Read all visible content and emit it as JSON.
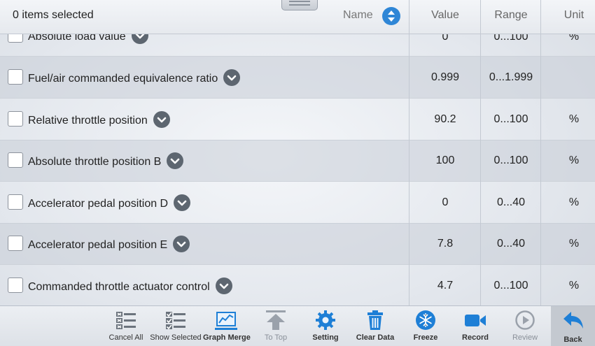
{
  "header": {
    "selection_text": "0 items selected",
    "sort_label": "Name",
    "col_value": "Value",
    "col_range": "Range",
    "col_unit": "Unit"
  },
  "rows": [
    {
      "name": "Absolute load value",
      "value": "0",
      "range": "0...100",
      "unit": "%"
    },
    {
      "name": "Fuel/air commanded equivalence ratio",
      "value": "0.999",
      "range": "0...1.999",
      "unit": ""
    },
    {
      "name": "Relative throttle position",
      "value": "90.2",
      "range": "0...100",
      "unit": "%"
    },
    {
      "name": "Absolute throttle position B",
      "value": "100",
      "range": "0...100",
      "unit": "%"
    },
    {
      "name": "Accelerator pedal position D",
      "value": "0",
      "range": "0...40",
      "unit": "%"
    },
    {
      "name": "Accelerator pedal position E",
      "value": "7.8",
      "range": "0...40",
      "unit": "%"
    },
    {
      "name": "Commanded throttle actuator control",
      "value": "4.7",
      "range": "0...100",
      "unit": "%"
    }
  ],
  "toolbar": {
    "cancel_all": "Cancel All",
    "show_selected": "Show Selected",
    "graph_merge": "Graph Merge",
    "to_top": "To Top",
    "setting": "Setting",
    "clear_data": "Clear Data",
    "freeze": "Freeze",
    "record": "Record",
    "review": "Review",
    "back": "Back"
  },
  "colors": {
    "accent_blue": "#1e7fd6",
    "icon_gray": "#5d6670",
    "dim_gray": "#9aa1ab"
  },
  "icons": [
    "sort-icon",
    "chevron-down-icon",
    "cancel-all-icon",
    "show-selected-icon",
    "graph-merge-icon",
    "to-top-icon",
    "setting-icon",
    "clear-data-icon",
    "freeze-icon",
    "record-icon",
    "review-icon",
    "back-icon"
  ]
}
